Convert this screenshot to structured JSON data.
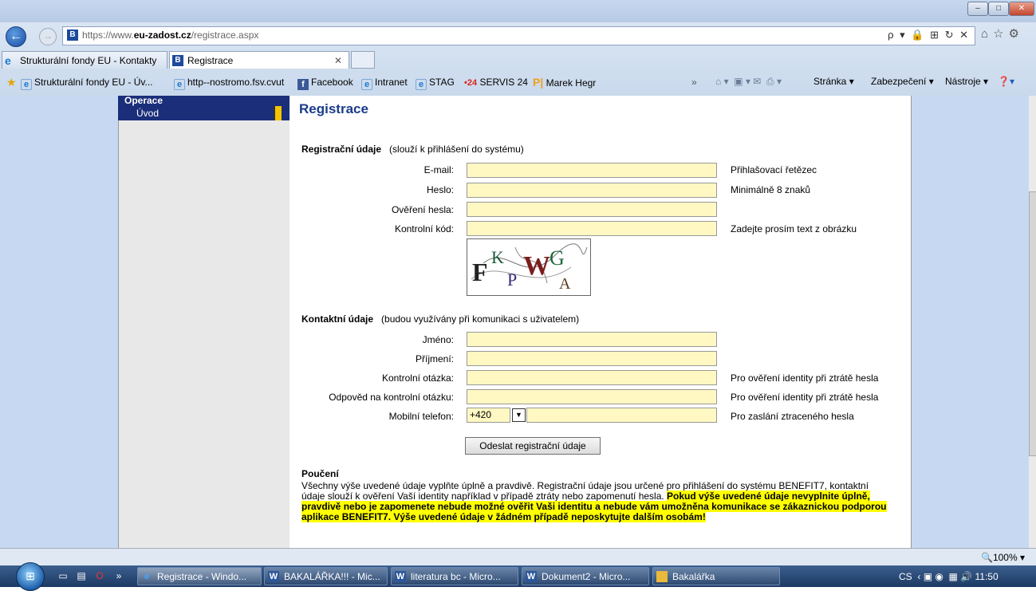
{
  "browser": {
    "url_prefix": "https://www.",
    "url_domain": "eu-zadost.cz",
    "url_path": "/registrace.aspx",
    "url_tools": "ρ ▾ 🔒 ⊞ ↻ ✕",
    "window_controls": {
      "minimize": "–",
      "maximize": "□",
      "close": "✕"
    },
    "tabs": [
      {
        "label": "Strukturální fondy EU - Kontakty"
      },
      {
        "label": "Registrace"
      }
    ],
    "tab_close": "✕",
    "favorites": [
      {
        "label": "Strukturální fondy EU - Úv..."
      },
      {
        "label": "http--nostromo.fsv.cvut"
      },
      {
        "label": "Facebook"
      },
      {
        "label": "Intranet"
      },
      {
        "label": "STAG"
      },
      {
        "label": "SERVIS 24"
      },
      {
        "label": "Marek Hegr"
      }
    ],
    "servis_prefix": "•24",
    "commands": {
      "stranka": "Stránka ▾",
      "zabezpeceni": "Zabezpečení ▾",
      "nastroje": "Nástroje ▾"
    },
    "zoom": "100%"
  },
  "sidebar": {
    "heading": "Operace",
    "item": "Úvod"
  },
  "page": {
    "title": "Registrace",
    "reg_section": {
      "title": "Registrační údaje",
      "note": "(slouží k přihlášení do systému)"
    },
    "reg_fields": [
      {
        "label": "E-mail:",
        "hint": "Přihlašovací řetězec"
      },
      {
        "label": "Heslo:",
        "hint": "Minimálně 8 znaků"
      },
      {
        "label": "Ověření hesla:",
        "hint": ""
      },
      {
        "label": "Kontrolní kód:",
        "hint": "Zadejte prosím text z obrázku"
      }
    ],
    "captcha_letters": [
      "F",
      "K",
      "P",
      "W",
      "G",
      "A"
    ],
    "contact_section": {
      "title": "Kontaktní údaje",
      "note": "(budou využívány při komunikaci s uživatelem)"
    },
    "contact_fields": [
      {
        "label": "Jméno:",
        "hint": ""
      },
      {
        "label": "Příjmení:",
        "hint": ""
      },
      {
        "label": "Kontrolní otázka:",
        "hint": "Pro ověření identity při ztrátě hesla"
      },
      {
        "label": "Odpověd na kontrolní otázku:",
        "hint": "Pro ověření identity při ztrátě hesla"
      },
      {
        "label": "Mobilní telefon:",
        "hint": "Pro zaslání ztraceného hesla"
      }
    ],
    "phone_prefix": "+420",
    "submit_label": "Odeslat registrační údaje",
    "notice_title": "Poučení",
    "notice_text": "Všechny výše uvedené údaje vyplňte úplně a pravdivě. Registrační údaje jsou určené pro přihlášení do systému BENEFIT7, kontaktní údaje slouží k ověření Vaší identity například v případě ztráty nebo zapomenutí hesla. ",
    "notice_highlight": "Pokud výše uvedené údaje nevyplnite úplně, pravdivě nebo je zapomenete nebude možné ověřit Vaši identitu a nebude vám umožněna komunikace se zákaznickou podporou aplikace BENEFIT7. Výše uvedené údaje v žádném případě neposkytujte dalším osobám!"
  },
  "taskbar": {
    "buttons": [
      {
        "label": "Registrace - Windo..."
      },
      {
        "label": "BAKALÁŘKA!!! - Mic..."
      },
      {
        "label": "literatura bc - Micro..."
      },
      {
        "label": "Dokument2 - Micro..."
      },
      {
        "label": "Bakalářka"
      }
    ],
    "language": "CS",
    "time": "11:50"
  },
  "colors": {
    "input_bg": "#fff8c2",
    "title_blue": "#1a3c8b",
    "menu_bg": "#1a2e7a",
    "page_bg": "#c7d9f2",
    "highlight": "#ffff00"
  }
}
